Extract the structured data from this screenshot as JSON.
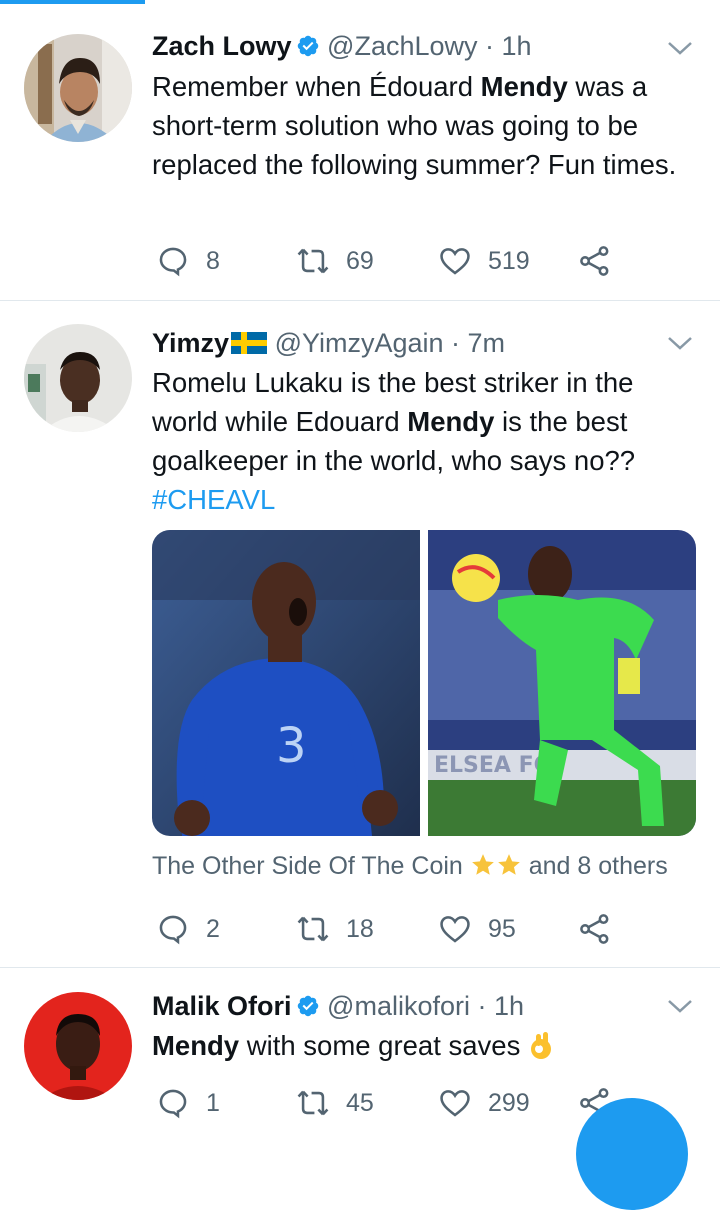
{
  "tweets": [
    {
      "name": "Zach Lowy",
      "handle": "@ZachLowy",
      "time": "· 1h",
      "text_parts": [
        "Remember when Édouard ",
        "Mendy",
        " was a short-term solution who was going to be replaced the following summer? Fun times."
      ],
      "replies": "8",
      "retweets": "69",
      "likes": "519"
    },
    {
      "name": "Yimzy",
      "handle": "@YimzyAgain",
      "time": "· 7m",
      "text_parts": [
        "Romelu Lukaku is the best striker in the world while Edouard ",
        "Mendy",
        " is the best goalkeeper in the world, who says no??"
      ],
      "hashtag": "#CHEAVL",
      "liked_by": "The Other Side Of The Coin",
      "liked_by_suffix": "and 8 others",
      "replies": "2",
      "retweets": "18",
      "likes": "95"
    },
    {
      "name": "Malik Ofori",
      "handle": "@malikofori",
      "time": "· 1h",
      "text_parts": [
        "Mendy",
        " with some great saves "
      ],
      "replies": "1",
      "retweets": "45",
      "likes": "299"
    }
  ],
  "colors": {
    "accent": "#1d9bf0",
    "muted": "#536471",
    "divider": "#e1e8ed"
  },
  "icons": {
    "reply": "reply-icon",
    "retweet": "retweet-icon",
    "like": "heart-icon",
    "share": "share-icon",
    "verified": "verified-badge-icon",
    "caret": "chevron-down-icon",
    "compose": "compose-fab"
  }
}
